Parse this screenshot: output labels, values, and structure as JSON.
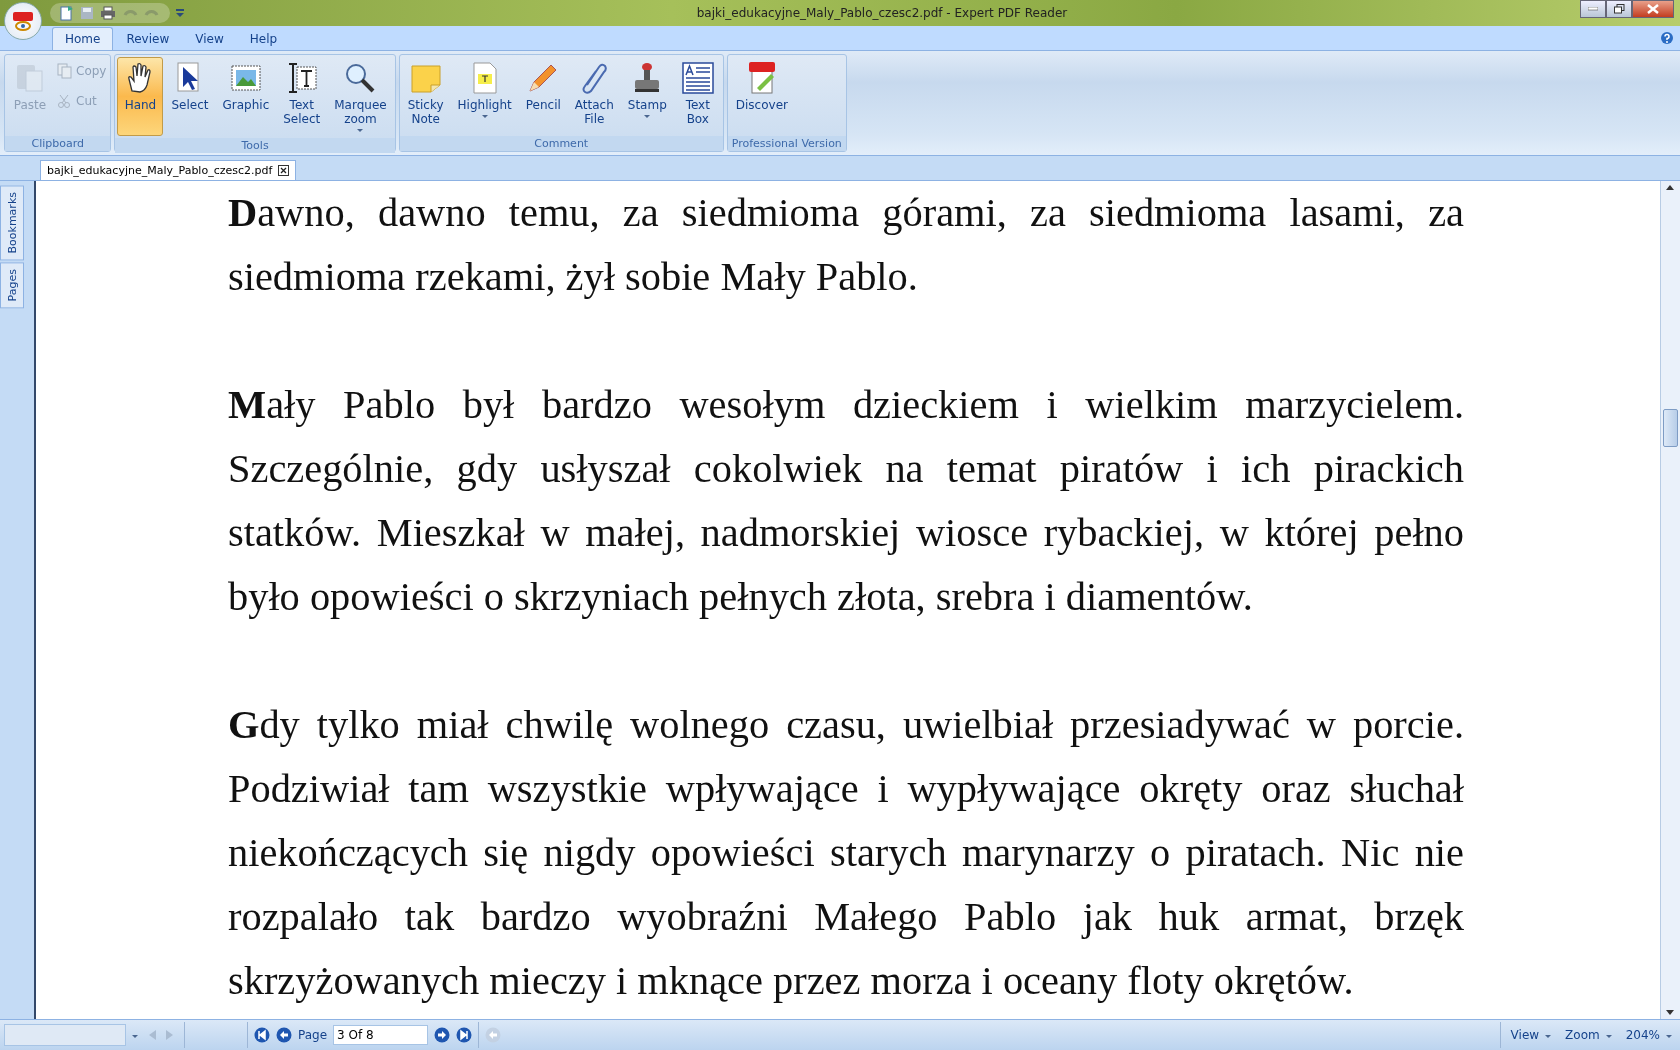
{
  "window": {
    "title": "bajki_edukacyjne_Maly_Pablo_czesc2.pdf - Expert PDF Reader"
  },
  "menu_tabs": [
    {
      "label": "Home",
      "selected": true
    },
    {
      "label": "Review",
      "selected": false
    },
    {
      "label": "View",
      "selected": false
    },
    {
      "label": "Help",
      "selected": false
    }
  ],
  "ribbon_groups": [
    {
      "label": "Clipboard",
      "buttons": [
        {
          "label": "Paste",
          "kind": "large",
          "selected": false,
          "disabled": true,
          "dropdown": false
        },
        {
          "label": "Copy",
          "kind": "small",
          "selected": false,
          "disabled": true,
          "dropdown": false
        },
        {
          "label": "Cut",
          "kind": "small",
          "selected": false,
          "disabled": true,
          "dropdown": false
        }
      ]
    },
    {
      "label": "Tools",
      "buttons": [
        {
          "label": "Hand",
          "kind": "large",
          "selected": true,
          "disabled": false,
          "dropdown": false
        },
        {
          "label": "Select",
          "kind": "large",
          "selected": false,
          "disabled": false,
          "dropdown": false
        },
        {
          "label": "Graphic",
          "kind": "large",
          "selected": false,
          "disabled": false,
          "dropdown": false
        },
        {
          "label": "Text\nSelect",
          "kind": "large",
          "selected": false,
          "disabled": false,
          "dropdown": false
        },
        {
          "label": "Marquee\nzoom",
          "kind": "large",
          "selected": false,
          "disabled": false,
          "dropdown": true
        }
      ]
    },
    {
      "label": "Comment",
      "buttons": [
        {
          "label": "Sticky\nNote",
          "kind": "large",
          "selected": false,
          "disabled": false,
          "dropdown": false
        },
        {
          "label": "Highlight",
          "kind": "large",
          "selected": false,
          "disabled": false,
          "dropdown": true
        },
        {
          "label": "Pencil",
          "kind": "large",
          "selected": false,
          "disabled": false,
          "dropdown": false
        },
        {
          "label": "Attach\nFile",
          "kind": "large",
          "selected": false,
          "disabled": false,
          "dropdown": false
        },
        {
          "label": "Stamp",
          "kind": "large",
          "selected": false,
          "disabled": false,
          "dropdown": true
        },
        {
          "label": "Text\nBox",
          "kind": "large",
          "selected": false,
          "disabled": false,
          "dropdown": false
        }
      ]
    },
    {
      "label": "Professional Version",
      "buttons": [
        {
          "label": "Discover",
          "kind": "large",
          "selected": false,
          "disabled": false,
          "dropdown": false
        }
      ]
    }
  ],
  "document_tabs": [
    {
      "label": "bajki_edukacyjne_Maly_Pablo_czesc2.pdf",
      "selected": true
    }
  ],
  "side_tabs": [
    {
      "label": "Bookmarks",
      "selected": false
    },
    {
      "label": "Pages",
      "selected": false
    }
  ],
  "paragraphs": [
    "**D**awno, dawno temu, za siedmioma górami, za siedmioma lasami, za siedmioma rzekami, żył sobie Mały Pablo.",
    "**M**ały Pablo był bardzo wesołym dzieckiem i wielkim marzycielem. Szczególnie, gdy usłyszał cokolwiek na temat piratów i ich pirackich statków. Mieszkał w małej, nadmorskiej wiosce rybackiej, w której pełno było opowieści o skrzyniach pełnych złota, srebra i diamentów.",
    "**G**dy tylko miał chwilę wolnego czasu, uwielbiał przesiadywać w porcie. Podziwiał tam wszystkie wpływające i wypływające okręty oraz słuchał niekończących się nigdy opowieści starych marynarzy o piratach. Nic nie rozpalało tak bardzo wyobraźni Małego Pablo jak huk armat, brzęk skrzyżowanych mieczy i mknące przez morza i oceany floty okrętów."
  ],
  "status_bar": {
    "page_label": "Page",
    "page_value": "3 Of 8",
    "view": "View",
    "zoom": "Zoom",
    "zoom_value": "204%"
  }
}
